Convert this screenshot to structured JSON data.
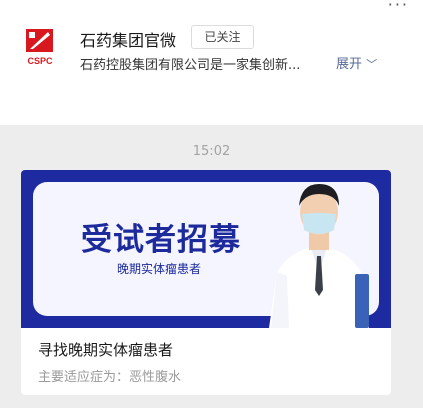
{
  "account": {
    "logo_text": "CSPC",
    "name": "石药集团官微",
    "follow_label": "已关注",
    "description": "石药控股集团有限公司是一家集创新...",
    "expand_label": "展开"
  },
  "menu": {
    "more_label": "···"
  },
  "message": {
    "time": "15:02"
  },
  "article": {
    "banner_title": "受试者招募",
    "banner_subtitle": "晚期实体瘤患者",
    "title": "寻找晚期实体瘤患者",
    "meta": "主要适应症为：恶性腹水"
  },
  "colors": {
    "brand_blue": "#1e2a9f",
    "logo_red": "#d7191f",
    "link": "#576b95"
  }
}
